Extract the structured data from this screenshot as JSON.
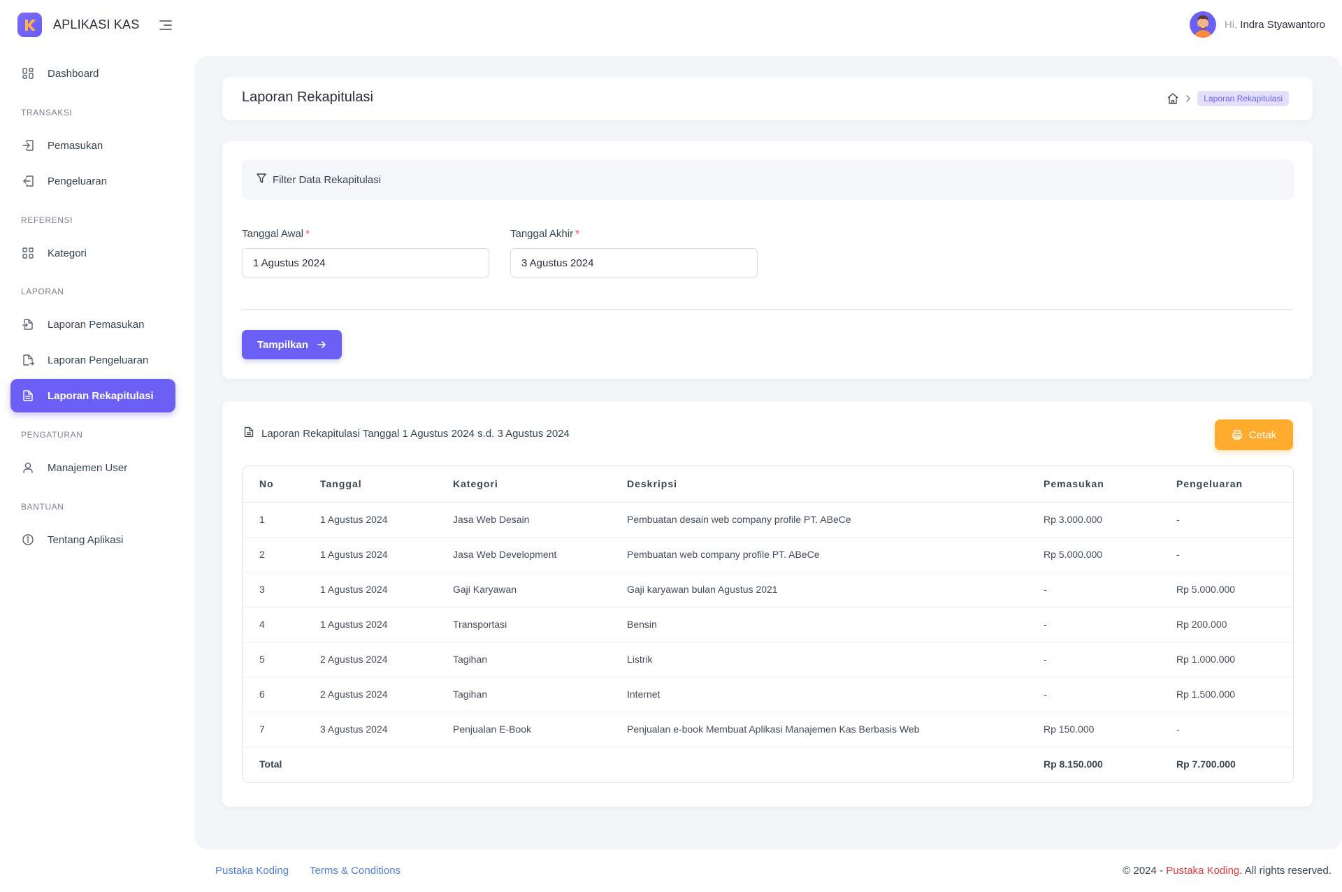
{
  "app": {
    "name": "APLIKASI KAS",
    "brand_color": "#6c5ff6"
  },
  "user": {
    "greeting": "Hi,",
    "name": "Indra Styawantoro"
  },
  "sidebar": {
    "items": [
      {
        "label": "Dashboard",
        "icon": "dashboard-grid-icon"
      },
      {
        "section": "TRANSAKSI"
      },
      {
        "label": "Pemasukan",
        "icon": "login-arrow-icon"
      },
      {
        "label": "Pengeluaran",
        "icon": "logout-arrow-icon"
      },
      {
        "section": "REFERENSI"
      },
      {
        "label": "Kategori",
        "icon": "category-grid-icon"
      },
      {
        "section": "LAPORAN"
      },
      {
        "label": "Laporan Pemasukan",
        "icon": "file-in-icon"
      },
      {
        "label": "Laporan Pengeluaran",
        "icon": "file-out-icon"
      },
      {
        "label": "Laporan Rekapitulasi",
        "icon": "file-text-icon",
        "active": true
      },
      {
        "section": "PENGATURAN"
      },
      {
        "label": "Manajemen User",
        "icon": "user-icon"
      },
      {
        "section": "BANTUAN"
      },
      {
        "label": "Tentang Aplikasi",
        "icon": "info-circle-icon"
      }
    ]
  },
  "page": {
    "title": "Laporan Rekapitulasi",
    "breadcrumb_current": "Laporan Rekapitulasi"
  },
  "filter": {
    "title": "Filter Data Rekapitulasi",
    "start_label": "Tanggal Awal",
    "start_value": "1 Agustus 2024",
    "end_label": "Tanggal Akhir",
    "end_value": "3 Agustus 2024",
    "required_mark": "*",
    "submit_label": "Tampilkan"
  },
  "report": {
    "title": "Laporan Rekapitulasi Tanggal 1 Agustus 2024 s.d. 3 Agustus 2024",
    "print_label": "Cetak",
    "columns": [
      "No",
      "Tanggal",
      "Kategori",
      "Deskripsi",
      "Pemasukan",
      "Pengeluaran"
    ],
    "rows": [
      [
        "1",
        "1 Agustus 2024",
        "Jasa Web Desain",
        "Pembuatan desain web company profile PT. ABeCe",
        "Rp 3.000.000",
        "-"
      ],
      [
        "2",
        "1 Agustus 2024",
        "Jasa Web Development",
        "Pembuatan web company profile PT. ABeCe",
        "Rp 5.000.000",
        "-"
      ],
      [
        "3",
        "1 Agustus 2024",
        "Gaji Karyawan",
        "Gaji karyawan bulan Agustus 2021",
        "-",
        "Rp 5.000.000"
      ],
      [
        "4",
        "1 Agustus 2024",
        "Transportasi",
        "Bensin",
        "-",
        "Rp 200.000"
      ],
      [
        "5",
        "2 Agustus 2024",
        "Tagihan",
        "Listrik",
        "-",
        "Rp 1.000.000"
      ],
      [
        "6",
        "2 Agustus 2024",
        "Tagihan",
        "Internet",
        "-",
        "Rp 1.500.000"
      ],
      [
        "7",
        "3 Agustus 2024",
        "Penjualan E-Book",
        "Penjualan e-book Membuat Aplikasi Manajemen Kas Berbasis Web",
        "Rp 150.000",
        "-"
      ]
    ],
    "total_label": "Total",
    "total_pemasukan": "Rp 8.150.000",
    "total_pengeluaran": "Rp 7.700.000"
  },
  "footer": {
    "link1": "Pustaka Koding",
    "link2": "Terms & Conditions",
    "copyright_prefix": "© 2024 - ",
    "copyright_brand": "Pustaka Koding",
    "copyright_suffix": ". All rights reserved."
  }
}
